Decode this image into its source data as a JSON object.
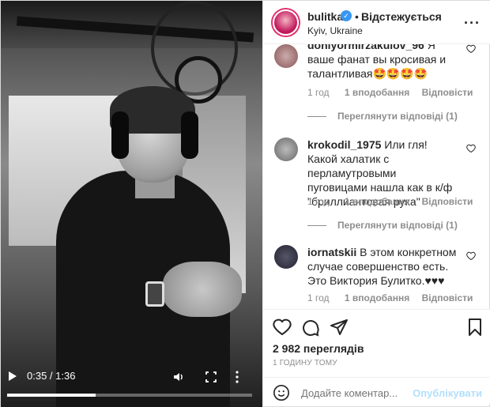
{
  "video": {
    "time": "0:35 / 1:36",
    "progress_fraction": 0.36,
    "icons": [
      "play-icon",
      "volume-icon",
      "picture-in-picture-icon",
      "more-vertical-icon"
    ]
  },
  "post": {
    "username": "bulitka",
    "follow_status": "Відстежується",
    "location": "Kyiv, Ukraine",
    "accent": "#3897f0"
  },
  "comments": [
    {
      "username": "doniyormirzakulov_96",
      "text": "Я ваше фанат вы кросивая и талантливая🤩🤩🤩🤩",
      "time": "1 год",
      "likes": "1 вподобання",
      "reply": "Відповісти"
    },
    {
      "view_replies": "Переглянути відповіді (1)"
    },
    {
      "username": "krokodil_1975",
      "text": "Или гля! Какой халатик с перламутровыми пуговицами нашла как в к/ф \"бриллиантовая рука\"",
      "time": "1 год",
      "likes": "1 вподобання",
      "reply": "Відповісти"
    },
    {
      "view_replies": "Переглянути відповіді (1)"
    },
    {
      "username": "iornatskii",
      "text": "В этом конкретном случае совершенство есть. Это Виктория Булитко.♥♥♥",
      "time": "1 год",
      "likes": "1 вподобання",
      "reply": "Відповісти"
    }
  ],
  "stats": {
    "views": "2 982 переглядів",
    "ago": "1 ГОДИНУ ТОМУ"
  },
  "add_comment": {
    "placeholder": "Додайте коментар...",
    "publish": "Опублікувати"
  }
}
